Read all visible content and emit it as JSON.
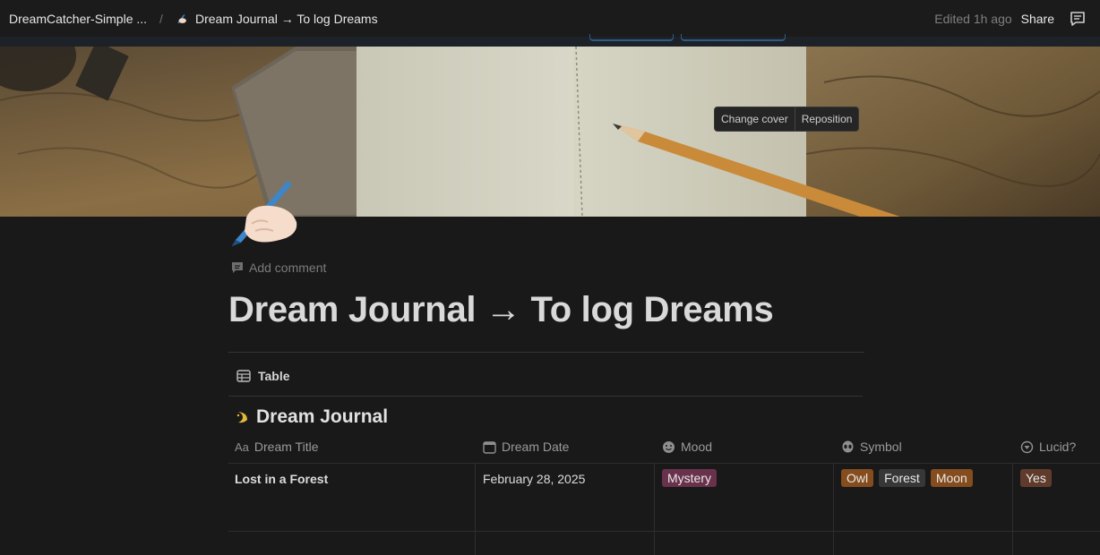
{
  "breadcrumb": {
    "workspace": "DreamCatcher-Simple ...",
    "separator": "/",
    "page": "Dream Journal → To log Dreams"
  },
  "topbar": {
    "edited": "Edited 1h ago",
    "share": "Share"
  },
  "cover": {
    "change_cover": "Change cover",
    "reposition": "Reposition"
  },
  "page": {
    "add_comment": "Add comment",
    "title": "Dream Journal → To log Dreams"
  },
  "view": {
    "tab_label": "Table"
  },
  "database": {
    "title": "Dream Journal",
    "columns": [
      {
        "label": "Dream Title",
        "icon": "title-aa-icon"
      },
      {
        "label": "Dream Date",
        "icon": "calendar-icon"
      },
      {
        "label": "Mood",
        "icon": "smiley-icon"
      },
      {
        "label": "Symbol",
        "icon": "alien-icon"
      },
      {
        "label": "Lucid?",
        "icon": "select-circle-icon"
      }
    ],
    "rows": [
      {
        "title": "Lost in a Forest",
        "date": "February 28, 2025",
        "mood": "Mystery",
        "symbols": [
          "Owl",
          "Forest",
          "Moon"
        ],
        "lucid": "Yes"
      }
    ]
  },
  "colors": {
    "background": "#191919",
    "mood_mystery": "#69314c",
    "symbol_owl": "#854c1d",
    "symbol_forest": "#373737",
    "symbol_moon": "#854c1d",
    "lucid_yes": "#603b2c"
  }
}
